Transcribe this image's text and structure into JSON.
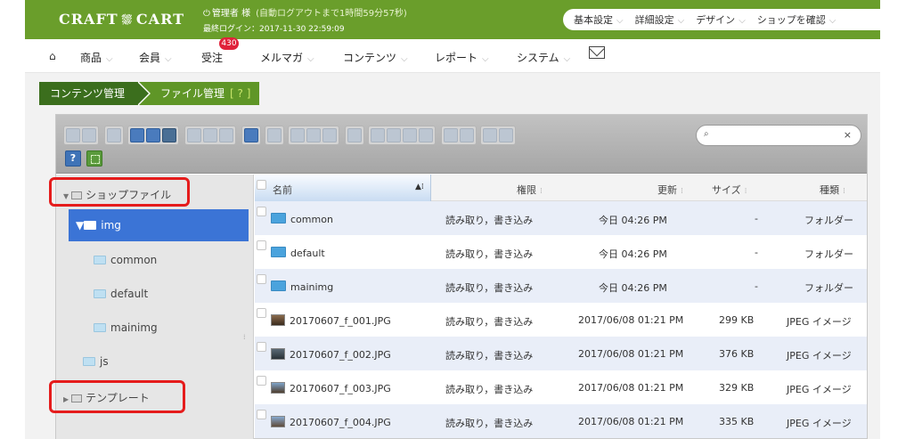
{
  "header": {
    "logo_text": "CRAFT 🛒 CART",
    "logo_left": "CRAFT",
    "logo_right": "CART",
    "admin_label": "管理者 様",
    "auto_logout": "(自動ログアウトまで1時間59分57秒)",
    "last_login": "最終ログイン：2017-11-30 22:59:09",
    "settings_menu": [
      {
        "label": "基本設定"
      },
      {
        "label": "詳細設定"
      },
      {
        "label": "デザイン"
      },
      {
        "label": "ショップを確認"
      }
    ]
  },
  "nav": {
    "items": [
      {
        "label": "商品"
      },
      {
        "label": "会員"
      },
      {
        "label": "受注",
        "badge": "430"
      },
      {
        "label": "メルマガ"
      },
      {
        "label": "コンテンツ"
      },
      {
        "label": "レポート"
      },
      {
        "label": "システム"
      }
    ]
  },
  "breadcrumb": {
    "parent": "コンテンツ管理",
    "current": "ファイル管理",
    "help": "[ ? ]"
  },
  "search": {
    "icon_glyph": "⌕",
    "clear_glyph": "×"
  },
  "toolbar": {
    "help_glyph": "?"
  },
  "tree": {
    "root1": "ショップファイル",
    "selected": "img",
    "children": [
      {
        "label": "common"
      },
      {
        "label": "default"
      },
      {
        "label": "mainimg"
      }
    ],
    "sibling": "js",
    "root2": "テンプレート"
  },
  "list": {
    "headers": {
      "name": "名前",
      "perm": "権限",
      "updated": "更新",
      "size": "サイズ",
      "kind": "種類"
    },
    "rows": [
      {
        "name": "common",
        "perm": "読み取り，書き込み",
        "updated": "今日 04:26 PM",
        "size": "-",
        "kind": "フォルダー",
        "icon": "folder-icon"
      },
      {
        "name": "default",
        "perm": "読み取り，書き込み",
        "updated": "今日 04:26 PM",
        "size": "-",
        "kind": "フォルダー",
        "icon": "folder-icon"
      },
      {
        "name": "mainimg",
        "perm": "読み取り，書き込み",
        "updated": "今日 04:26 PM",
        "size": "-",
        "kind": "フォルダー",
        "icon": "folder-icon"
      },
      {
        "name": "20170607_f_001.JPG",
        "perm": "読み取り，書き込み",
        "updated": "2017/06/08 01:21 PM",
        "size": "299 KB",
        "kind": "JPEG イメージ",
        "icon": "image-thumbnail-icon"
      },
      {
        "name": "20170607_f_002.JPG",
        "perm": "読み取り，書き込み",
        "updated": "2017/06/08 01:21 PM",
        "size": "376 KB",
        "kind": "JPEG イメージ",
        "icon": "image-thumbnail-icon"
      },
      {
        "name": "20170607_f_003.JPG",
        "perm": "読み取り，書き込み",
        "updated": "2017/06/08 01:21 PM",
        "size": "329 KB",
        "kind": "JPEG イメージ",
        "icon": "image-thumbnail-icon"
      },
      {
        "name": "20170607_f_004.JPG",
        "perm": "読み取り，書き込み",
        "updated": "2017/06/08 01:21 PM",
        "size": "335 KB",
        "kind": "JPEG イメージ",
        "icon": "image-thumbnail-icon"
      }
    ]
  },
  "colors": {
    "header_green": "#6a9e2b",
    "breadcrumb_dark": "#3b6e1d",
    "selection_blue": "#3b74d6",
    "highlight_red": "#e51c1c",
    "badge_red": "#e0223a"
  }
}
